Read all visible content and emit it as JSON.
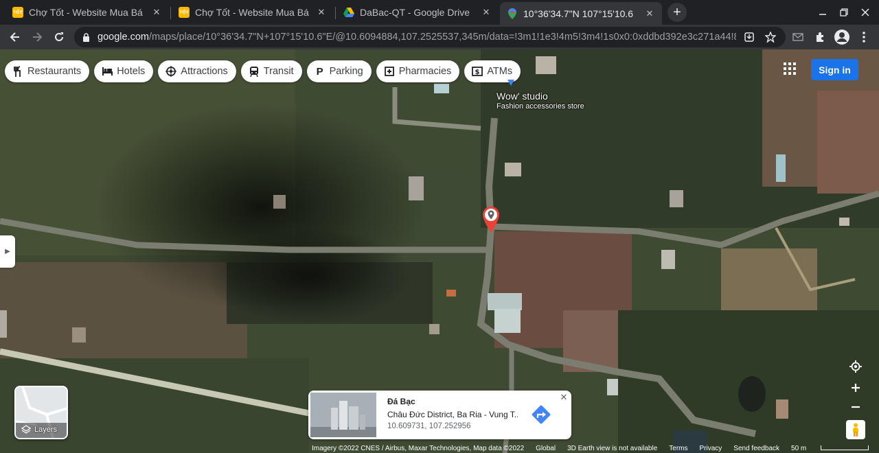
{
  "browser": {
    "tabs": [
      {
        "title": "Chợ Tốt - Website Mua Bá",
        "icon": "chotot-favicon",
        "active": false
      },
      {
        "title": "Chợ Tốt - Website Mua Bá",
        "icon": "chotot-favicon",
        "active": false
      },
      {
        "title": "DaBac-QT - Google Drive",
        "icon": "google-drive-favicon",
        "active": false
      },
      {
        "title": "10°36'34.7\"N 107°15'10.6",
        "icon": "google-maps-favicon",
        "active": true
      }
    ],
    "chotot_icon_text": "TỐT",
    "url_main": "google.com",
    "url_rest": "/maps/place/10°36'34.7\"N+107°15'10.6\"E/@10.6094884,107.2525537,345m/data=!3m1!1e3!4m5!3m4!1s0x0:0xddbd392e3c271a44!8m..."
  },
  "maps": {
    "chips": [
      {
        "label": "Restaurants",
        "icon": "restaurant-icon"
      },
      {
        "label": "Hotels",
        "icon": "hotel-icon"
      },
      {
        "label": "Attractions",
        "icon": "attractions-icon"
      },
      {
        "label": "Transit",
        "icon": "transit-icon"
      },
      {
        "label": "Parking",
        "icon": "parking-icon"
      },
      {
        "label": "Pharmacies",
        "icon": "pharmacy-icon"
      },
      {
        "label": "ATMs",
        "icon": "atm-icon"
      }
    ],
    "sign_in": "Sign in",
    "place_label": {
      "name": "Wow' studio",
      "type": "Fashion accessories store"
    },
    "layers_label": "Layers",
    "info_card": {
      "name": "Đá Bạc",
      "address": "Châu Đức District, Ba Ria - Vung T...",
      "coords": "10.609731, 107.252956"
    },
    "attribution": {
      "imagery": "Imagery ©2022 CNES / Airbus, Maxar Technologies, Map data ©2022",
      "global": "Global",
      "earth": "3D Earth view is not available",
      "terms": "Terms",
      "privacy": "Privacy",
      "feedback": "Send feedback",
      "scale": "50 m"
    },
    "colors": {
      "pin": "#ea4335",
      "sign_in": "#1a73e8",
      "directions": "#4285f4"
    }
  }
}
